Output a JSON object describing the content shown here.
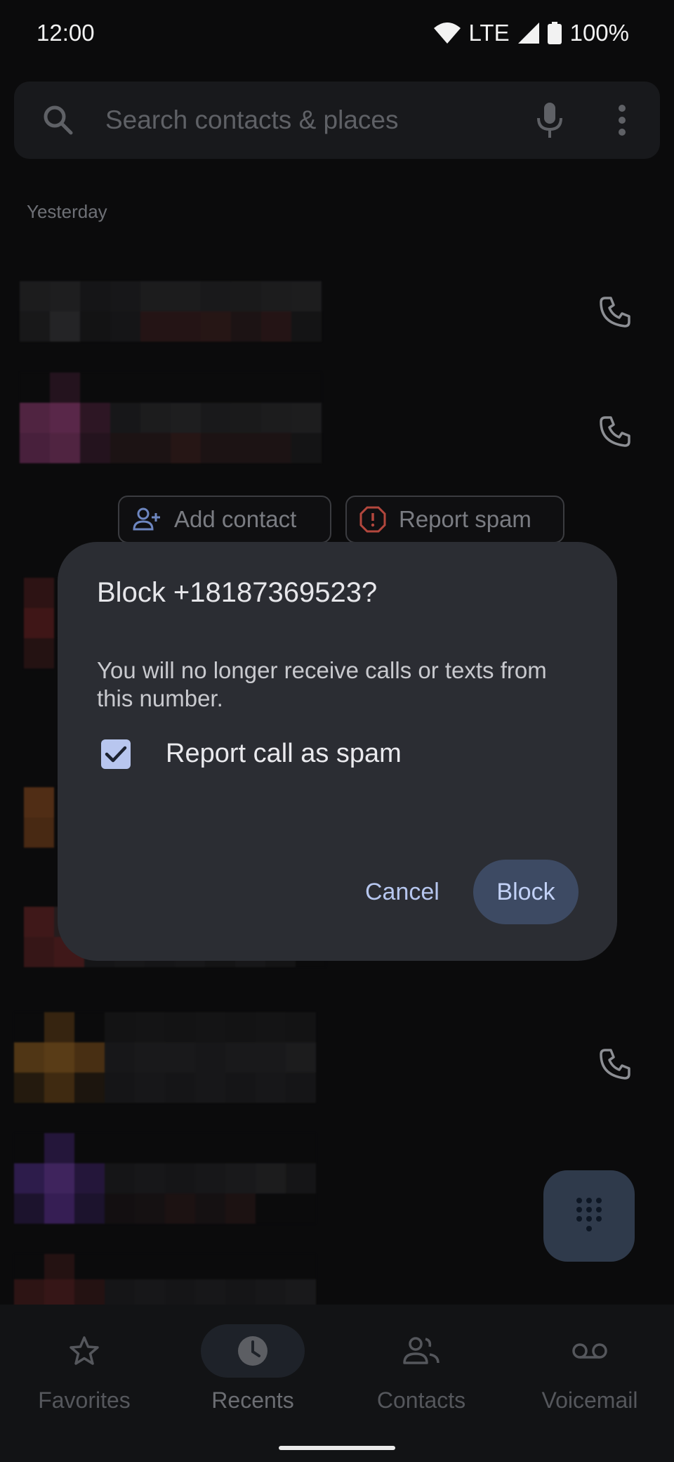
{
  "status_bar": {
    "time": "12:00",
    "network": "LTE",
    "battery": "100%"
  },
  "search": {
    "placeholder": "Search contacts & places"
  },
  "call_log": {
    "section_header": "Yesterday",
    "quick_actions": {
      "add_contact": "Add contact",
      "report_spam": "Report spam"
    }
  },
  "dialog": {
    "title": "Block +18187369523?",
    "body": "You will no longer receive calls or texts from this number.",
    "checkbox_label": "Report call as spam",
    "checkbox_checked": true,
    "cancel_label": "Cancel",
    "block_label": "Block"
  },
  "bottom_nav": {
    "items": [
      {
        "label": "Favorites",
        "icon": "star-icon"
      },
      {
        "label": "Recents",
        "icon": "clock-icon",
        "active": true
      },
      {
        "label": "Contacts",
        "icon": "people-icon"
      },
      {
        "label": "Voicemail",
        "icon": "voicemail-icon"
      }
    ]
  },
  "colors": {
    "background": "#0b0b0c",
    "dialog": "#2b2d33",
    "accent": "#b6c6ee",
    "block_button": "#3d4a63",
    "fab": "#2f3a4b"
  }
}
